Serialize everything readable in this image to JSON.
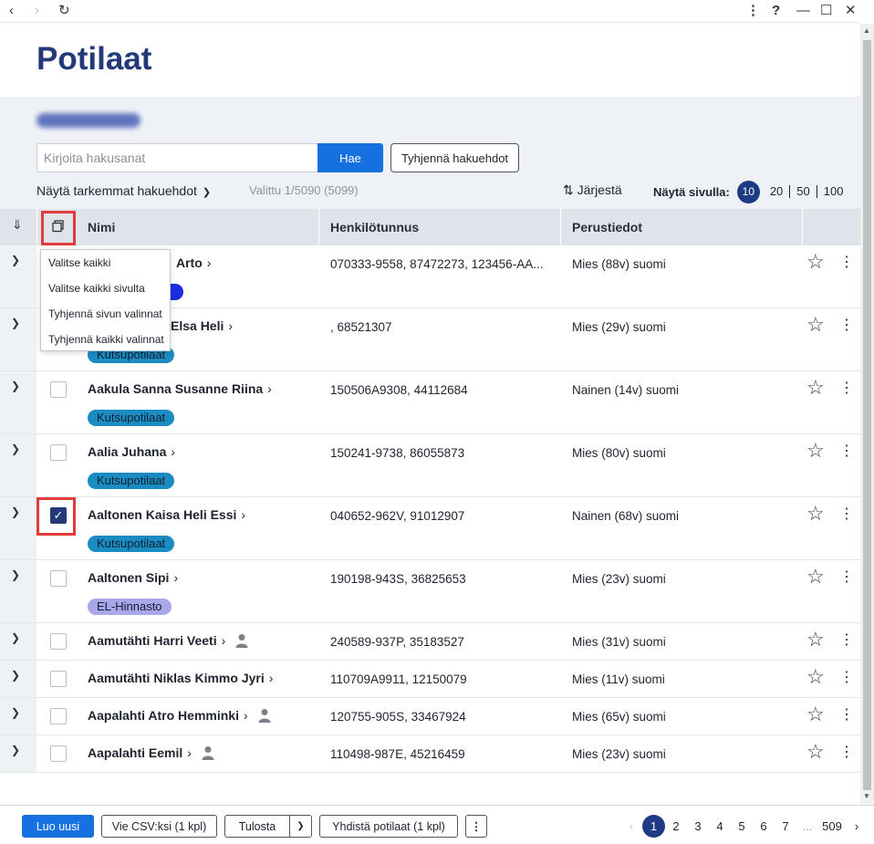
{
  "browser": {
    "back_icon": "chevron-left-icon",
    "forward_icon": "chevron-right-icon",
    "reload_icon": "reload-icon",
    "menu_icon": "kebab-icon",
    "help_label": "?"
  },
  "page": {
    "title": "Potilaat"
  },
  "search": {
    "placeholder": "Kirjoita hakusanat",
    "value": "",
    "search_label": "Hae",
    "clear_label": "Tyhjennä hakuehdot",
    "advanced_label": "Näytä tarkemmat hakuehdot",
    "selected_info": "Valittu 1/5090 (5099)",
    "sort_label": "Järjestä",
    "pagesize_label": "Näytä sivulla:",
    "pagesize_options": [
      "10",
      "20",
      "50",
      "100"
    ],
    "pagesize_selected": "10"
  },
  "table": {
    "headers": {
      "name": "Nimi",
      "hetu": "Henkilötunnus",
      "info": "Perustiedot"
    },
    "rows": [
      {
        "name": "Aakkula Arto",
        "visible_name": "Arto",
        "hetu": "070333-9558, 87472273, 123456-AA...",
        "info": "Mies (88v) suomi",
        "tag": "",
        "checked": false,
        "person": false
      },
      {
        "name": "Elsa Heli",
        "visible_name": "Elsa Heli",
        "hetu": ", 68521307",
        "info": "Mies (29v) suomi",
        "tag": "Kutsupotilaat",
        "checked": false,
        "person": false
      },
      {
        "name": "Aakula Sanna Susanne Riina",
        "hetu": "150506A9308, 44112684",
        "info": "Nainen (14v) suomi",
        "tag": "Kutsupotilaat",
        "checked": false,
        "person": false
      },
      {
        "name": "Aalia Juhana",
        "hetu": "150241-9738, 86055873",
        "info": "Mies (80v) suomi",
        "tag": "Kutsupotilaat",
        "checked": false,
        "person": false
      },
      {
        "name": "Aaltonen Kaisa Heli Essi",
        "hetu": "040652-962V, 91012907",
        "info": "Nainen (68v) suomi",
        "tag": "Kutsupotilaat",
        "checked": true,
        "person": false
      },
      {
        "name": "Aaltonen Sipi",
        "hetu": "190198-943S, 36825653",
        "info": "Mies (23v) suomi",
        "tag": "EL-Hinnasto",
        "checked": false,
        "person": false
      },
      {
        "name": "Aamutähti Harri Veeti",
        "hetu": "240589-937P, 35183527",
        "info": "Mies (31v) suomi",
        "tag": "",
        "checked": false,
        "person": true
      },
      {
        "name": "Aamutähti Niklas Kimmo Jyri",
        "hetu": "110709A9911, 12150079",
        "info": "Mies (11v) suomi",
        "tag": "",
        "checked": false,
        "person": false
      },
      {
        "name": "Aapalahti Atro Hemminki",
        "hetu": "120755-905S, 33467924",
        "info": "Mies (65v) suomi",
        "tag": "",
        "checked": false,
        "person": true
      },
      {
        "name": "Aapalahti Eemil",
        "hetu": "110498-987E, 45216459",
        "info": "Mies (23v) suomi",
        "tag": "",
        "checked": false,
        "person": true
      }
    ]
  },
  "select_menu": {
    "items": [
      "Valitse kaikki",
      "Valitse kaikki sivulta",
      "Tyhjennä sivun valinnat",
      "Tyhjennä kaikki valinnat"
    ]
  },
  "toolbar": {
    "new_label": "Luo uusi",
    "csv_label": "Vie CSV:ksi (1 kpl)",
    "print_label": "Tulosta",
    "merge_label": "Yhdistä potilaat (1 kpl)"
  },
  "pagination": {
    "pages": [
      "1",
      "2",
      "3",
      "4",
      "5",
      "6",
      "7"
    ],
    "ellipsis": "...",
    "last": "509",
    "current": "1"
  },
  "colors": {
    "primary": "#1570e0",
    "navy": "#1d3b85",
    "tag_kutsu": "#1b8cc2",
    "tag_el": "#a9a6ea",
    "highlight": "#e23b3b"
  }
}
